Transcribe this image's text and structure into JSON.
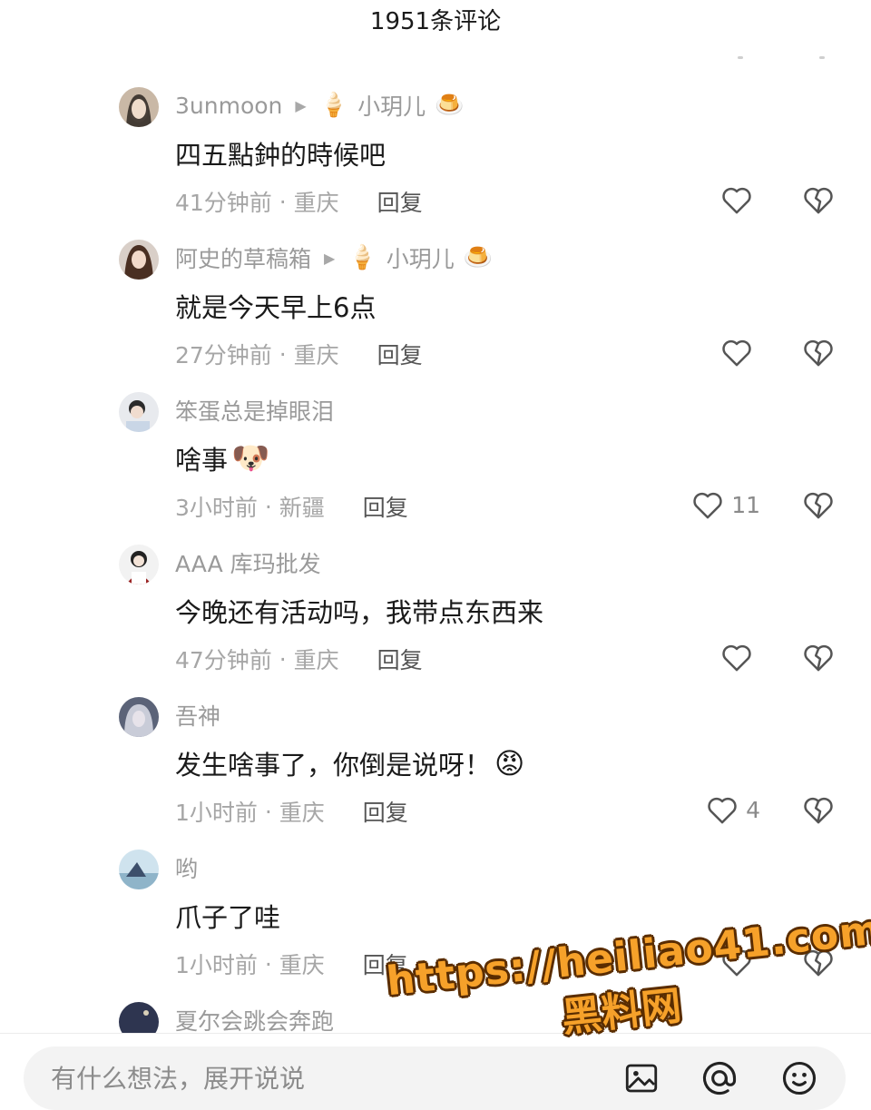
{
  "header": {
    "title": "1951条评论"
  },
  "comments": [
    {
      "username": "3unmoon",
      "reply_to": "小玥儿",
      "reply_to_prefix_emoji": "🍦",
      "reply_to_suffix_emoji": "🍮",
      "text": "四五點鈡的時候吧",
      "text_emoji": "",
      "time": "41分钟前",
      "location": "重庆",
      "reply_label": "回复",
      "likes": ""
    },
    {
      "username": "阿史的草稿箱",
      "reply_to": "小玥儿",
      "reply_to_prefix_emoji": "🍦",
      "reply_to_suffix_emoji": "🍮",
      "text": "就是今天早上6点",
      "text_emoji": "",
      "time": "27分钟前",
      "location": "重庆",
      "reply_label": "回复",
      "likes": ""
    },
    {
      "username": "笨蛋总是掉眼泪",
      "reply_to": "",
      "text": "啥事",
      "text_emoji": "🐶",
      "time": "3小时前",
      "location": "新疆",
      "reply_label": "回复",
      "likes": "11"
    },
    {
      "username": "AAA 库玛批发",
      "reply_to": "",
      "text": "今晚还有活动吗，我带点东西来",
      "text_emoji": "",
      "time": "47分钟前",
      "location": "重庆",
      "reply_label": "回复",
      "likes": ""
    },
    {
      "username": "吾神",
      "reply_to": "",
      "text": "发生啥事了，你倒是说呀！",
      "text_emoji": "😡",
      "time": "1小时前",
      "location": "重庆",
      "reply_label": "回复",
      "likes": "4"
    },
    {
      "username": "哟",
      "reply_to": "",
      "text": "爪子了哇",
      "text_emoji": "",
      "time": "1小时前",
      "location": "重庆",
      "reply_label": "回复",
      "likes": ""
    },
    {
      "username": "夏尔会跳会奔跑",
      "reply_to": "",
      "text": "",
      "text_emoji": "",
      "time": "",
      "location": "",
      "reply_label": "",
      "likes": ""
    }
  ],
  "input": {
    "placeholder": "有什么想法，展开说说"
  },
  "icons": {
    "like": "heart-icon",
    "dislike": "broken-heart-icon",
    "image": "image-icon",
    "mention": "at-icon",
    "emoji": "emoji-face-icon"
  },
  "watermark": {
    "url": "https://heiliao41.com",
    "name": "黑料网"
  },
  "colors": {
    "accent_watermark": "#f6a12a",
    "muted_text": "#9a9a9a"
  }
}
